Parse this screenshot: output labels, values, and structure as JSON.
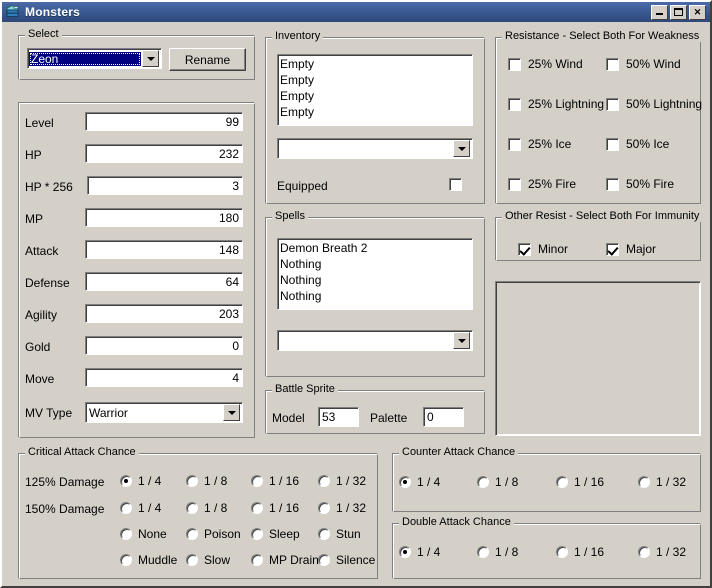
{
  "window": {
    "title": "Monsters",
    "icon": "monster-database-icon",
    "buttons": {
      "minimize": "minimize-button",
      "maximize": "maximize-button",
      "close": "close-button"
    },
    "colors": {
      "face": "#d4d0c8",
      "titlebar_start": "#4a6aa8",
      "titlebar_end": "#2d4878",
      "selection": "#000080"
    }
  },
  "select_group": {
    "legend": "Select",
    "combo_value": "Zeon",
    "rename_label": "Rename"
  },
  "stats": {
    "rows": [
      {
        "label": "Level",
        "value": "99"
      },
      {
        "label": "HP",
        "value": "232"
      },
      {
        "label": "HP * 256",
        "value": "3"
      },
      {
        "label": "MP",
        "value": "180"
      },
      {
        "label": "Attack",
        "value": "148"
      },
      {
        "label": "Defense",
        "value": "64"
      },
      {
        "label": "Agility",
        "value": "203"
      },
      {
        "label": "Gold",
        "value": "0"
      },
      {
        "label": "Move",
        "value": "4"
      }
    ],
    "mv_type": {
      "label": "MV Type",
      "value": "Warrior"
    }
  },
  "inventory": {
    "legend": "Inventory",
    "items": [
      "Empty",
      "Empty",
      "Empty",
      "Empty"
    ],
    "combo_value": "",
    "equipped_label": "Equipped",
    "equipped_checked": false
  },
  "spells": {
    "legend": "Spells",
    "items": [
      "Demon Breath 2",
      "Nothing",
      "Nothing",
      "Nothing"
    ],
    "combo_value": ""
  },
  "battle_sprite": {
    "legend": "Battle Sprite",
    "model_label": "Model",
    "model_value": "53",
    "palette_label": "Palette",
    "palette_value": "0"
  },
  "resistance": {
    "legend": "Resistance - Select Both For Weakness",
    "checkboxes": [
      {
        "label": "25% Wind",
        "checked": false
      },
      {
        "label": "50% Wind",
        "checked": false
      },
      {
        "label": "25% Lightning",
        "checked": false
      },
      {
        "label": "50% Lightning",
        "checked": false
      },
      {
        "label": "25% Ice",
        "checked": false
      },
      {
        "label": "50% Ice",
        "checked": false
      },
      {
        "label": "25% Fire",
        "checked": false
      },
      {
        "label": "50% Fire",
        "checked": false
      }
    ]
  },
  "other_resist": {
    "legend": "Other Resist - Select Both For Immunity",
    "checkboxes": [
      {
        "label": "Minor",
        "checked": true
      },
      {
        "label": "Major",
        "checked": true
      }
    ]
  },
  "sprite_preview": {
    "name": "sprite-preview-panel"
  },
  "critical_attack": {
    "legend": "Critical Attack Chance",
    "row1_label": "125% Damage",
    "row2_label": "150% Damage",
    "row1": [
      {
        "label": "1 / 4",
        "selected": true
      },
      {
        "label": "1 / 8",
        "selected": false
      },
      {
        "label": "1 / 16",
        "selected": false
      },
      {
        "label": "1 / 32",
        "selected": false
      }
    ],
    "row2": [
      {
        "label": "1 / 4",
        "selected": false
      },
      {
        "label": "1 / 8",
        "selected": false
      },
      {
        "label": "1 / 16",
        "selected": false
      },
      {
        "label": "1 / 32",
        "selected": false
      }
    ],
    "row3": [
      {
        "label": "None",
        "selected": false
      },
      {
        "label": "Poison",
        "selected": false
      },
      {
        "label": "Sleep",
        "selected": false
      },
      {
        "label": "Stun",
        "selected": false
      }
    ],
    "row4": [
      {
        "label": "Muddle",
        "selected": false
      },
      {
        "label": "Slow",
        "selected": false
      },
      {
        "label": "MP Drain",
        "selected": false
      },
      {
        "label": "Silence",
        "selected": false
      }
    ]
  },
  "counter_attack": {
    "legend": "Counter Attack Chance",
    "options": [
      {
        "label": "1 / 4",
        "selected": true
      },
      {
        "label": "1 / 8",
        "selected": false
      },
      {
        "label": "1 / 16",
        "selected": false
      },
      {
        "label": "1 / 32",
        "selected": false
      }
    ]
  },
  "double_attack": {
    "legend": "Double Attack Chance",
    "options": [
      {
        "label": "1 / 4",
        "selected": true
      },
      {
        "label": "1 / 8",
        "selected": false
      },
      {
        "label": "1 / 16",
        "selected": false
      },
      {
        "label": "1 / 32",
        "selected": false
      }
    ]
  }
}
